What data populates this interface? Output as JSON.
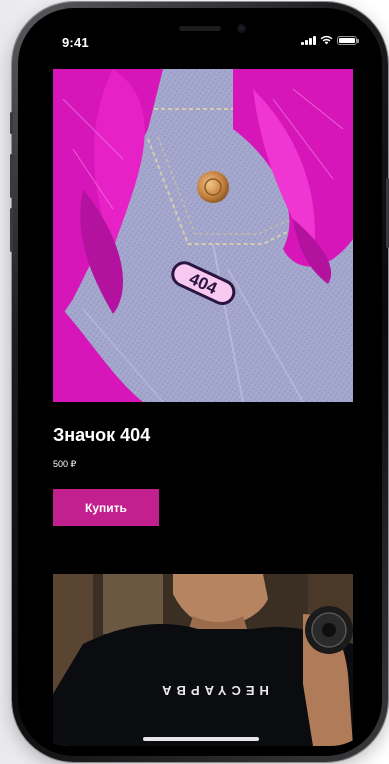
{
  "status_bar": {
    "time": "9:41"
  },
  "product": {
    "title": "Значок 404",
    "price": "500 ₽",
    "buy_label": "Купить",
    "pin_text": "404"
  },
  "next_product": {
    "shirt_text": "HECYAPBA"
  },
  "colors": {
    "accent": "#c2208e",
    "background": "#000000",
    "text": "#ffffff"
  },
  "icons": [
    "signal-icon",
    "wifi-icon",
    "battery-icon"
  ]
}
